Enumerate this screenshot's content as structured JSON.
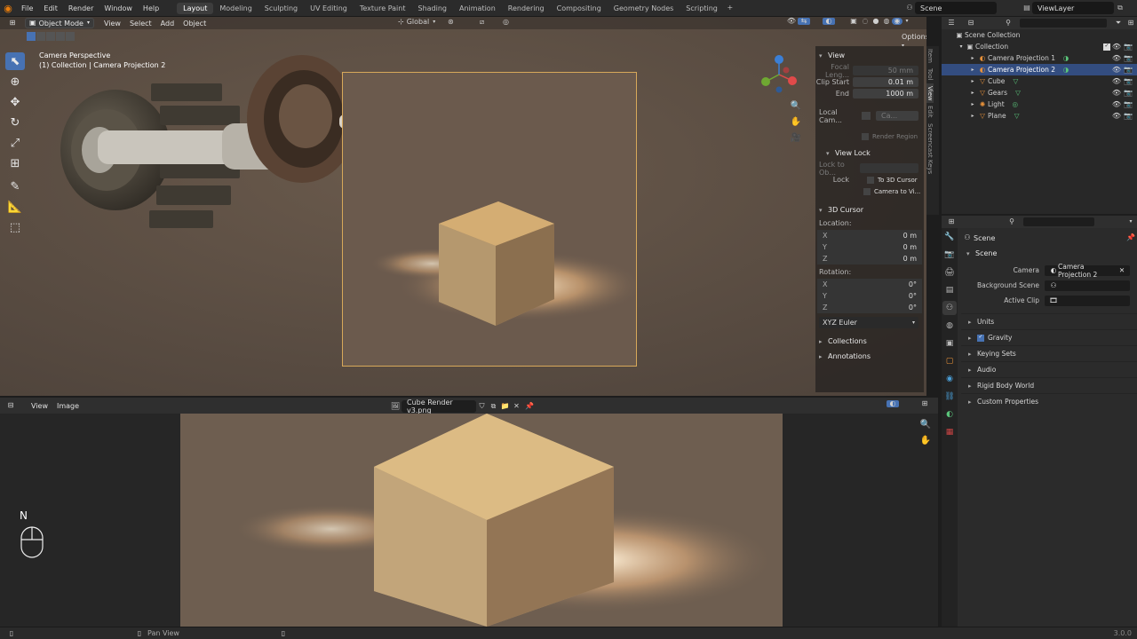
{
  "menu": {
    "items": [
      "File",
      "Edit",
      "Render",
      "Window",
      "Help"
    ]
  },
  "workspaces": [
    "Layout",
    "Modeling",
    "Sculpting",
    "UV Editing",
    "Texture Paint",
    "Shading",
    "Animation",
    "Rendering",
    "Compositing",
    "Geometry Nodes",
    "Scripting"
  ],
  "active_workspace": "Layout",
  "scene_name": "Scene",
  "view_layer": "ViewLayer",
  "viewport": {
    "mode": "Object Mode",
    "menus": [
      "View",
      "Select",
      "Add",
      "Object"
    ],
    "transform_orientation": "Global",
    "options_label": "Options",
    "camera_label": "Camera Perspective",
    "collection_label": "(1) Collection | Camera Projection 2"
  },
  "npanel": {
    "view_title": "View",
    "focal_length_label": "Focal Leng...",
    "focal_length_value": "50 mm",
    "clip_start_label": "Clip Start",
    "clip_start_value": "0.01 m",
    "clip_end_label": "End",
    "clip_end_value": "1000 m",
    "local_camera_label": "Local Cam...",
    "local_camera_value": "Ca...",
    "render_region_label": "Render Region",
    "view_lock_title": "View Lock",
    "lock_to_object_label": "Lock to Ob...",
    "lock_label": "Lock",
    "to_3d_cursor_label": "To 3D Cursor",
    "camera_to_view_label": "Camera to Vi...",
    "cursor_title": "3D Cursor",
    "location_label": "Location:",
    "location": [
      {
        "k": "X",
        "v": "0 m"
      },
      {
        "k": "Y",
        "v": "0 m"
      },
      {
        "k": "Z",
        "v": "0 m"
      }
    ],
    "rotation_label": "Rotation:",
    "rotation": [
      {
        "k": "X",
        "v": "0°"
      },
      {
        "k": "Y",
        "v": "0°"
      },
      {
        "k": "Z",
        "v": "0°"
      }
    ],
    "rotation_mode": "XYZ Euler",
    "collections_label": "Collections",
    "annotations_label": "Annotations",
    "tabs": [
      "Item",
      "Tool",
      "View",
      "Edit",
      "Screencast Keys"
    ]
  },
  "image_editor": {
    "menus": [
      "View",
      "Image"
    ],
    "image_name": "Cube Render v3.png"
  },
  "overlay_key": "N",
  "outliner": {
    "root": "Scene Collection",
    "collection": "Collection",
    "items": [
      "Camera Projection 1",
      "Camera Projection 2",
      "Cube",
      "Gears",
      "Light",
      "Plane"
    ],
    "selected_item": "Camera Projection 2"
  },
  "properties": {
    "context": "Scene",
    "panel_title": "Scene",
    "camera_label": "Camera",
    "camera_value": "Camera Projection 2",
    "background_scene_label": "Background Scene",
    "active_clip_label": "Active Clip",
    "subpanels": [
      "Units",
      "Gravity",
      "Keying Sets",
      "Audio",
      "Rigid Body World",
      "Custom Properties"
    ]
  },
  "status": {
    "pan_view": "Pan View",
    "version": "3.0.0"
  },
  "colors": {
    "accent": "#4772b3",
    "selection": "#334d80",
    "camera_frame": "#d7a85a"
  }
}
